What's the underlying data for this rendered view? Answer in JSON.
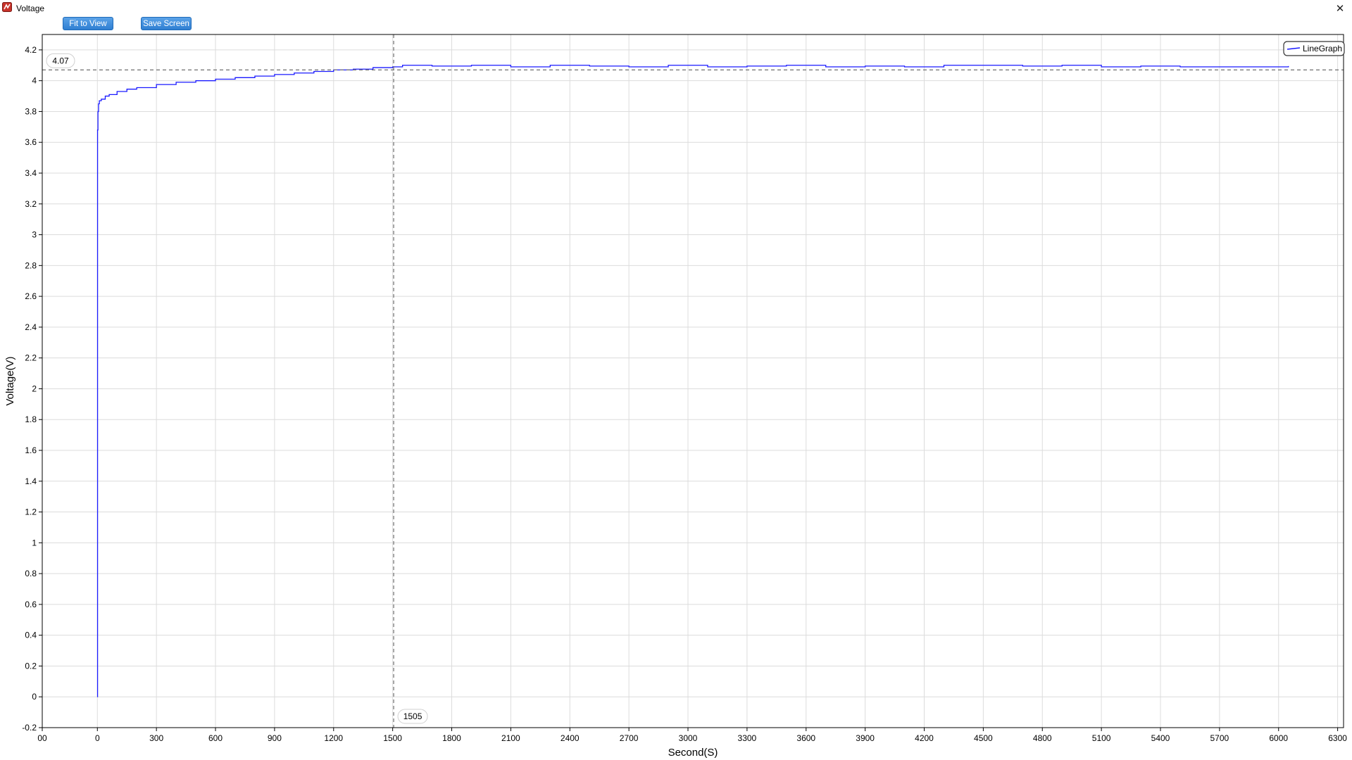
{
  "window": {
    "title": "Voltage",
    "close_glyph": "✕",
    "icon": "app-icon"
  },
  "toolbar": {
    "fit_label": "Fit to View",
    "save_label": "Save Screen"
  },
  "colors": {
    "series": "#1a1aff",
    "button_top": "#5aa2e8",
    "button_bottom": "#2f7fd2",
    "grid": "#dcdcdc",
    "cursor": "#707070"
  },
  "chart_data": {
    "type": "line",
    "xlabel": "Second(S)",
    "ylabel": "Voltage(V)",
    "xlim": [
      -280,
      6330
    ],
    "ylim": [
      -0.2,
      4.3
    ],
    "x_ticks": [
      {
        "value": -280,
        "label": "00"
      },
      {
        "value": 0,
        "label": "0"
      },
      {
        "value": 300,
        "label": "300"
      },
      {
        "value": 600,
        "label": "600"
      },
      {
        "value": 900,
        "label": "900"
      },
      {
        "value": 1200,
        "label": "1200"
      },
      {
        "value": 1500,
        "label": "1500"
      },
      {
        "value": 1800,
        "label": "1800"
      },
      {
        "value": 2100,
        "label": "2100"
      },
      {
        "value": 2400,
        "label": "2400"
      },
      {
        "value": 2700,
        "label": "2700"
      },
      {
        "value": 3000,
        "label": "3000"
      },
      {
        "value": 3300,
        "label": "3300"
      },
      {
        "value": 3600,
        "label": "3600"
      },
      {
        "value": 3900,
        "label": "3900"
      },
      {
        "value": 4200,
        "label": "4200"
      },
      {
        "value": 4500,
        "label": "4500"
      },
      {
        "value": 4800,
        "label": "4800"
      },
      {
        "value": 5100,
        "label": "5100"
      },
      {
        "value": 5400,
        "label": "5400"
      },
      {
        "value": 5700,
        "label": "5700"
      },
      {
        "value": 6000,
        "label": "6000"
      },
      {
        "value": 6300,
        "label": "6300"
      }
    ],
    "y_ticks": [
      {
        "value": -0.2,
        "label": "-0.2"
      },
      {
        "value": 0,
        "label": "0"
      },
      {
        "value": 0.2,
        "label": "0.2"
      },
      {
        "value": 0.4,
        "label": "0.4"
      },
      {
        "value": 0.6,
        "label": "0.6"
      },
      {
        "value": 0.8,
        "label": "0.8"
      },
      {
        "value": 1,
        "label": "1"
      },
      {
        "value": 1.2,
        "label": "1.2"
      },
      {
        "value": 1.4,
        "label": "1.4"
      },
      {
        "value": 1.6,
        "label": "1.6"
      },
      {
        "value": 1.8,
        "label": "1.8"
      },
      {
        "value": 2,
        "label": "2"
      },
      {
        "value": 2.2,
        "label": "2.2"
      },
      {
        "value": 2.4,
        "label": "2.4"
      },
      {
        "value": 2.6,
        "label": "2.6"
      },
      {
        "value": 2.8,
        "label": "2.8"
      },
      {
        "value": 3,
        "label": "3"
      },
      {
        "value": 3.2,
        "label": "3.2"
      },
      {
        "value": 3.4,
        "label": "3.4"
      },
      {
        "value": 3.6,
        "label": "3.6"
      },
      {
        "value": 3.8,
        "label": "3.8"
      },
      {
        "value": 4,
        "label": "4"
      },
      {
        "value": 4.2,
        "label": "4.2"
      }
    ],
    "grid": true,
    "legend": {
      "position": "top-right",
      "entries": [
        "LineGraph"
      ]
    },
    "cursor": {
      "x": 1505,
      "x_label": "1505",
      "y": 4.07,
      "y_label": "4.07"
    },
    "series": [
      {
        "name": "LineGraph",
        "x": [
          0,
          1,
          3,
          6,
          10,
          20,
          40,
          60,
          100,
          150,
          200,
          300,
          400,
          500,
          600,
          700,
          800,
          900,
          1000,
          1100,
          1200,
          1300,
          1400,
          1500,
          1550,
          1700,
          1900,
          2100,
          2300,
          2500,
          2700,
          2900,
          3100,
          3300,
          3500,
          3700,
          3900,
          4100,
          4300,
          4500,
          4700,
          4900,
          5100,
          5300,
          5500,
          5700,
          5900,
          6050
        ],
        "y": [
          0,
          3.68,
          3.8,
          3.85,
          3.87,
          3.88,
          3.9,
          3.91,
          3.93,
          3.945,
          3.955,
          3.975,
          3.99,
          4.0,
          4.01,
          4.02,
          4.03,
          4.04,
          4.05,
          4.06,
          4.07,
          4.075,
          4.085,
          4.09,
          4.1,
          4.095,
          4.1,
          4.09,
          4.1,
          4.095,
          4.09,
          4.1,
          4.09,
          4.095,
          4.1,
          4.09,
          4.095,
          4.09,
          4.1,
          4.1,
          4.095,
          4.1,
          4.09,
          4.095,
          4.09,
          4.09,
          4.09,
          4.095
        ]
      }
    ]
  }
}
